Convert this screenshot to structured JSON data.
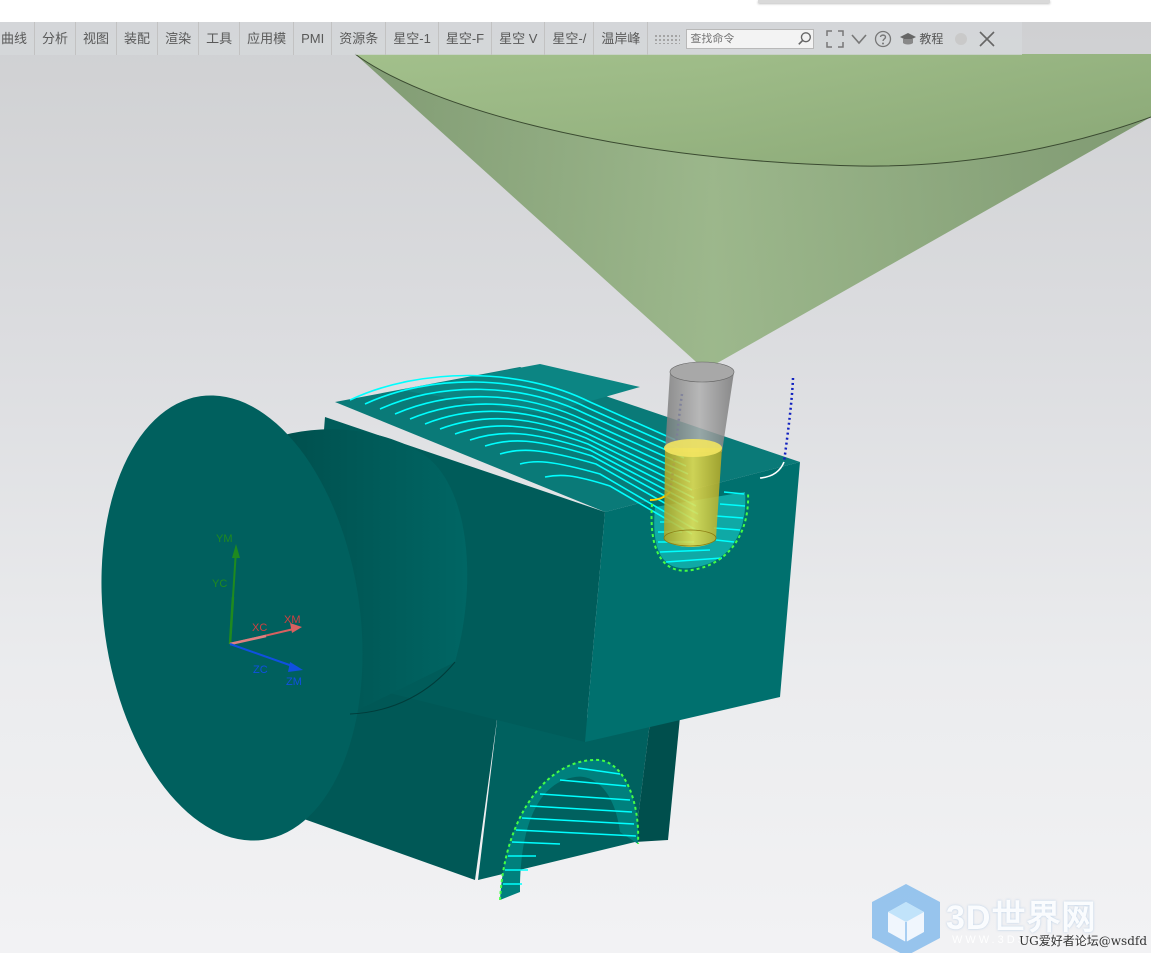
{
  "menubar": {
    "items": [
      {
        "id": "curve",
        "label": "曲线"
      },
      {
        "id": "analysis",
        "label": "分析"
      },
      {
        "id": "view",
        "label": "视图"
      },
      {
        "id": "assembly",
        "label": "装配"
      },
      {
        "id": "render",
        "label": "渲染"
      },
      {
        "id": "tools",
        "label": "工具"
      },
      {
        "id": "application",
        "label": "应用模"
      },
      {
        "id": "pmi",
        "label": "PMI"
      },
      {
        "id": "resource",
        "label": "资源条"
      },
      {
        "id": "star1",
        "label": "星空-1"
      },
      {
        "id": "star2",
        "label": "星空-F"
      },
      {
        "id": "star3",
        "label": "星空 V"
      },
      {
        "id": "star4",
        "label": "星空-/"
      },
      {
        "id": "wenan",
        "label": "温岸峰"
      }
    ],
    "search_placeholder": "查找命令",
    "tutorial_label": "教程"
  },
  "viewport": {
    "csys_labels": {
      "ym": "YM",
      "yc": "YC",
      "xc": "XC",
      "xm": "XM",
      "zc": "ZC",
      "zm": "ZM"
    },
    "colors": {
      "part_face": "#00605e",
      "part_dark": "#004a48",
      "part_light": "#0a7a78",
      "toolpath": "#00ffff",
      "tool_holder": "#8faa78",
      "tool_shank": "#9a9a9a",
      "tool_tip": "#e8d840",
      "axis_y": "#1f8a1f",
      "axis_x": "#d04040",
      "axis_z": "#1050e0"
    }
  },
  "watermark": {
    "brand": "3D世界网",
    "url": "WWW.3DSJW.COM",
    "credit": "UG爱好者论坛@wsdfd"
  }
}
